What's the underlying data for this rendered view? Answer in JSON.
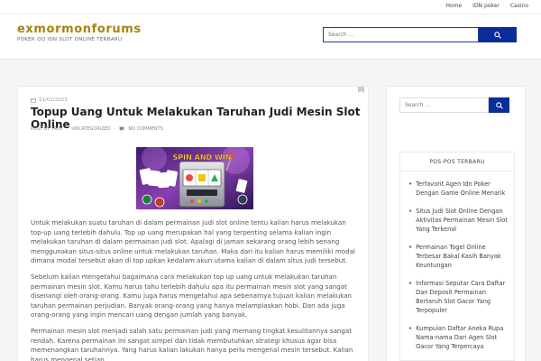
{
  "topnav": {
    "items": [
      "Home",
      "IDN poker",
      "Casino"
    ]
  },
  "header": {
    "site_title": "exmormonforums",
    "site_desc": "POKER QQ IDN SLOT ONLINE TERBARU",
    "search_placeholder": "Search ..."
  },
  "post": {
    "date": "11/02/2023",
    "title": "Topup Uang Untuk Melakukan Taruhan Judi Mesin Slot Online",
    "meta": {
      "author": "POST BY TROY",
      "category": "UNCATEGORIZED",
      "comments": "NO COMMENTS"
    },
    "image_text": "SPIN AND WIN",
    "paragraphs": [
      "Untuk melakukan suatu taruhan di dalam permainan judi slot online tentu kalian harus melakukan top-up uang terlebih dahulu. Top up uang merupakan hal yang terpenting selama kalian ingin melakukan taruhan di dalam permainan judi slot. Apalagi di jaman sekarang orang lebih senang menggunakan situs-situs online untuk melakukan taruhan. Maka dari itu kalian harus memiliki modal dimana modal tersebut akan di top upkan kedalam akun utama kalian di dalam situs judi tersebut.",
      "Sebelum kalian mengetahui bagaimana cara melakukan top up uang untuk melakukan taruhan permainan mesin slot. Kamu harus tahu terlebih dahulu apa itu permainan mesin slot yang sangat disenangi oleh orang-orang. Kamu juga harus mengetahui apa sebenarnya tujuan kalian melakukan taruhan permainan perjudian. Banyak orang-orang yang hanya melampiaskan hobi. Dan ada juga orang-orang yang ingin mencari uang dengan jumlah yang banyak.",
      "Permainan mesin slot menjadi salah satu permainan judi yang memang tingkat kesulitannya sangat rendah. Karena permainan ini sangat simpel dan tidak membutuhkan strategi khusus agar bisa memenangkan taruhannya. Yang harus kalian lakukan hanya perlu mengenal mesin tersebut. Kalian harus mengenal setiap"
    ]
  },
  "sidebar": {
    "search_placeholder": "Search ...",
    "recent_title": "POS-POS TERBARU",
    "recent_posts": [
      "Terfavorit Agen Idn Poker Dengan Game Online Menarik",
      "Situs Judi Slot Online Dengan Aktivitas Permainan Mesin Slot Yang Terkenal",
      "Permainan Togel Online Terbesar Bakal Kasih Banyak Keuntungan",
      "Informasi Seputar Cara Daftar Dan Deposit Permainan Bertaruh Slot Gacor Yang Terpopuler",
      "Kumpulan Daftar Aneka Rupa Nama-nama Dari Agen Slot Gacor Yang Terpercaya"
    ]
  },
  "colors": {
    "brand": "#a98210",
    "accent": "#0b2d9c"
  }
}
